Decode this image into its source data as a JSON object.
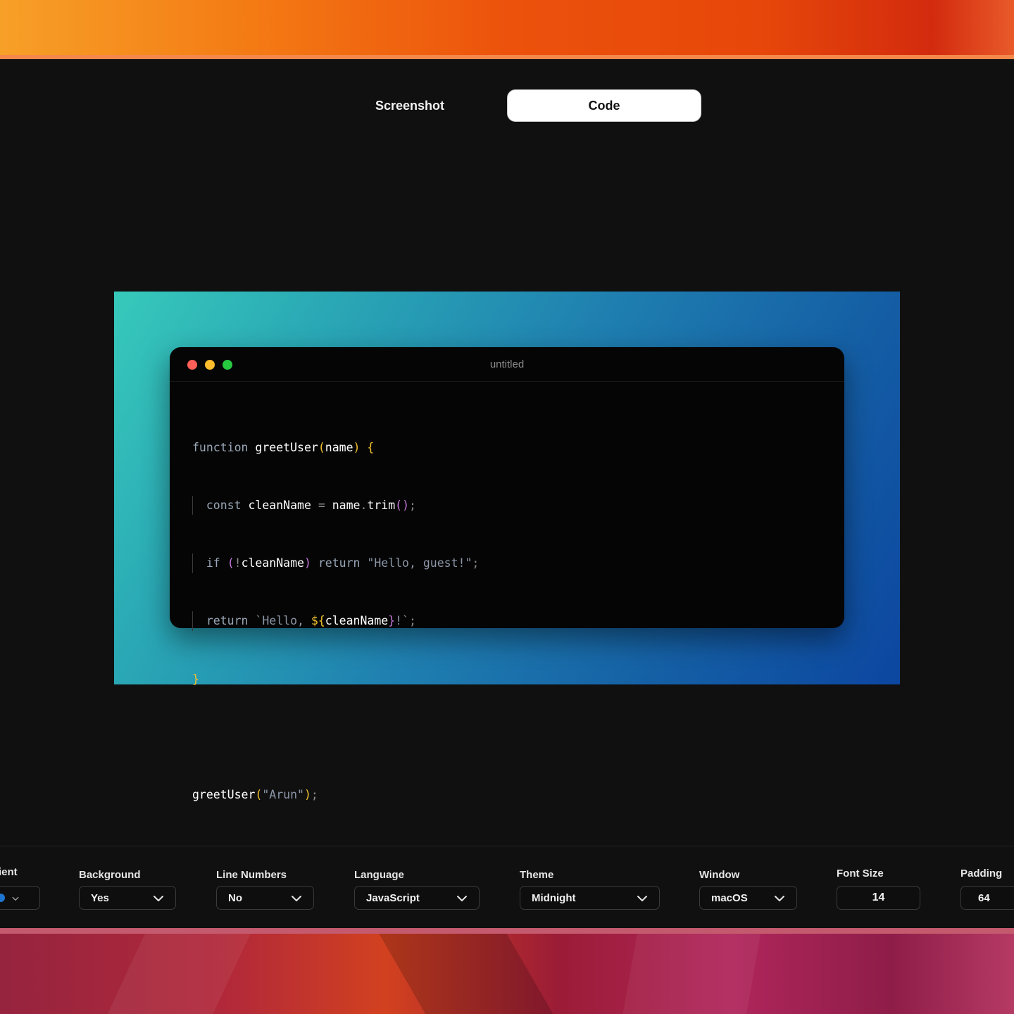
{
  "mode_tabs": {
    "screenshot": "Screenshot",
    "code": "Code"
  },
  "window": {
    "title": "untitled"
  },
  "code_tokens": {
    "function": "function",
    "greetUser": "greetUser",
    "name": "name",
    "const": "const",
    "cleanName": "cleanName",
    "trim": "trim",
    "if": "if",
    "return": "return",
    "hello_guest": "\"Hello, guest!\"",
    "hello_tpl": "`Hello, ",
    "tpl_end": "!`",
    "arun": "\"Arun\""
  },
  "toolbar": {
    "gradient": {
      "label": "Gradient",
      "color": "#1d75d0"
    },
    "background": {
      "label": "Background",
      "value": "Yes"
    },
    "line_numbers": {
      "label": "Line Numbers",
      "value": "No"
    },
    "language": {
      "label": "Language",
      "value": "JavaScript"
    },
    "theme": {
      "label": "Theme",
      "value": "Midnight"
    },
    "window": {
      "label": "Window",
      "value": "macOS"
    },
    "font_size": {
      "label": "Font Size",
      "value": "14"
    },
    "padding": {
      "label": "Padding",
      "value": "64"
    }
  },
  "colors": {
    "canvas_gradient_start": "#37c9bb",
    "canvas_gradient_end": "#0c46a0",
    "keyword": "#9aa7b8",
    "bracket": "#f2c12e",
    "punctuation": "#c477d8"
  }
}
